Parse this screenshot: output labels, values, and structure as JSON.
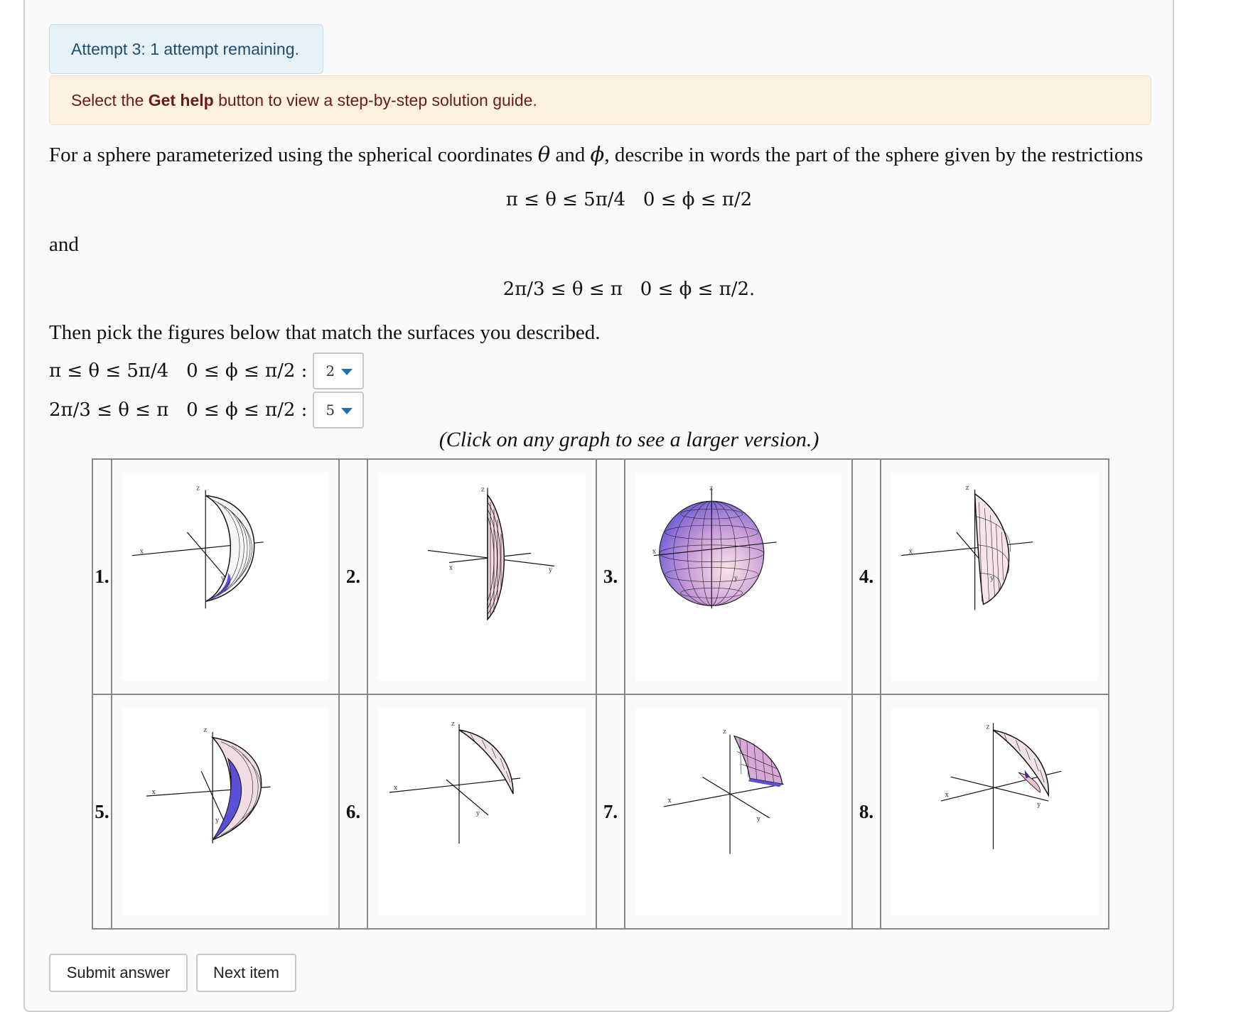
{
  "attempt_banner": "Attempt 3: 1 attempt remaining.",
  "help_banner": {
    "before": "Select the ",
    "bold": "Get help",
    "after": " button to view a step-by-step solution guide."
  },
  "problem": {
    "intro_a": "For a sphere parameterized using the spherical coordinates ",
    "theta": "θ",
    "and_word": " and ",
    "phi": "ϕ",
    "intro_b": ", describe in words the part of the sphere given by the restrictions",
    "restriction_1": "π ≤ θ ≤ 5π/4   0 ≤ ϕ ≤ π/2",
    "and_line": "and",
    "restriction_2": "2π/3 ≤ θ ≤ π   0 ≤ ϕ ≤ π/2.",
    "instruction": "Then pick the figures below that match the surfaces you described."
  },
  "answers": [
    {
      "label": "π ≤ θ ≤ 5π/4   0 ≤ ϕ ≤ π/2 :",
      "selected": "2"
    },
    {
      "label": "2π/3 ≤ θ ≤ π   0 ≤ ϕ ≤ π/2 :",
      "selected": "5"
    }
  ],
  "caption": "(Click on any graph to see a larger version.)",
  "figures": [
    {
      "number": "1."
    },
    {
      "number": "2."
    },
    {
      "number": "3."
    },
    {
      "number": "4."
    },
    {
      "number": "5."
    },
    {
      "number": "6."
    },
    {
      "number": "7."
    },
    {
      "number": "8."
    }
  ],
  "axis_labels": {
    "x": "x",
    "y": "y",
    "z": "z"
  },
  "buttons": {
    "submit": "Submit answer",
    "next": "Next item"
  },
  "colors": {
    "surface_blue": "#5a4fd6",
    "surface_pink": "#f0c0cc",
    "mesh": "#111111"
  }
}
